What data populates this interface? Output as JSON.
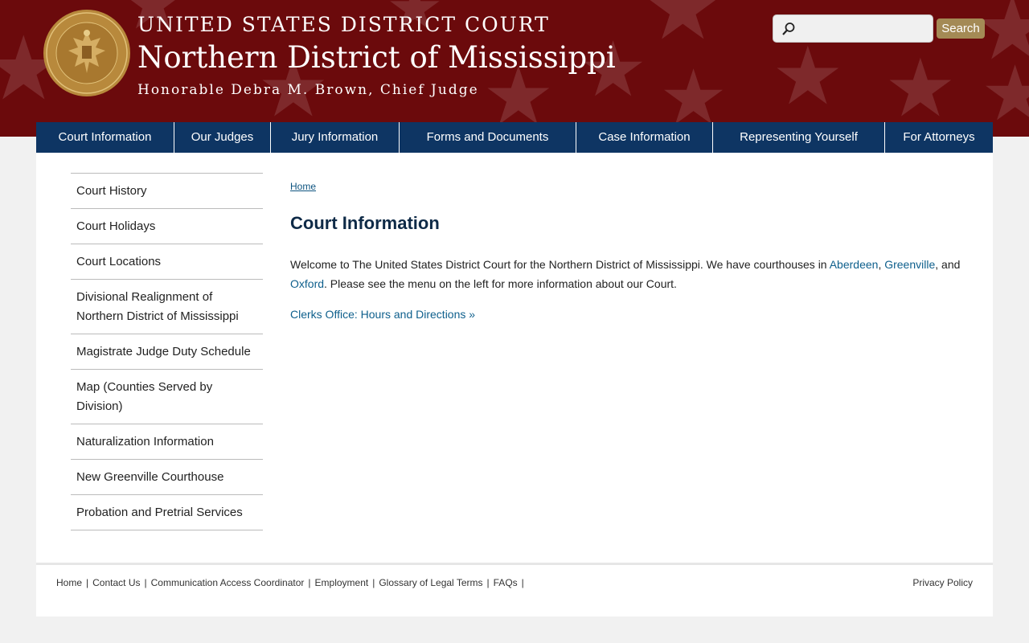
{
  "header": {
    "court_name": "UNITED STATES DISTRICT COURT",
    "district_name": "Northern District of Mississippi",
    "chief_judge": "Honorable Debra M. Brown, Chief Judge",
    "banner_color": "#6b0a0c",
    "seal_icon": "court-seal"
  },
  "search": {
    "placeholder": "",
    "value": "",
    "button_label": "Search",
    "button_color": "#a48a55"
  },
  "nav": {
    "items": [
      {
        "label": "Court Information"
      },
      {
        "label": "Our Judges"
      },
      {
        "label": "Jury Information"
      },
      {
        "label": "Forms and Documents"
      },
      {
        "label": "Case Information"
      },
      {
        "label": "Representing Yourself"
      },
      {
        "label": "For Attorneys"
      }
    ],
    "color": "#0e3563"
  },
  "sidebar": {
    "items": [
      {
        "label": "Court History"
      },
      {
        "label": "Court Holidays"
      },
      {
        "label": "Court Locations"
      },
      {
        "label": "Divisional Realignment of Northern District of Mississippi"
      },
      {
        "label": "Magistrate Judge Duty Schedule"
      },
      {
        "label": "Map (Counties Served by Division)"
      },
      {
        "label": "Naturalization Information"
      },
      {
        "label": "New Greenville Courthouse"
      },
      {
        "label": "Probation and Pretrial Services"
      }
    ]
  },
  "main": {
    "breadcrumb": "Home",
    "title": "Court Information",
    "intro_prefix": "Welcome to The United States District Court for the Northern District of Mississippi. We have courthouses in ",
    "link_aberdeen": "Aberdeen",
    "sep_comma": ", ",
    "link_greenville": "Greenville",
    "sep_and": ", and ",
    "link_oxford": "Oxford",
    "intro_suffix": ". Please see the menu on the left for more information about our Court.",
    "clerks_link": "Clerks Office: Hours and Directions »",
    "link_color": "#0e5f8c"
  },
  "footer": {
    "links": [
      {
        "label": "Home"
      },
      {
        "label": "Contact Us"
      },
      {
        "label": "Communication Access Coordinator"
      },
      {
        "label": "Employment"
      },
      {
        "label": "Glossary of Legal Terms"
      },
      {
        "label": "FAQs"
      }
    ],
    "separator": "|",
    "privacy": "Privacy Policy"
  }
}
